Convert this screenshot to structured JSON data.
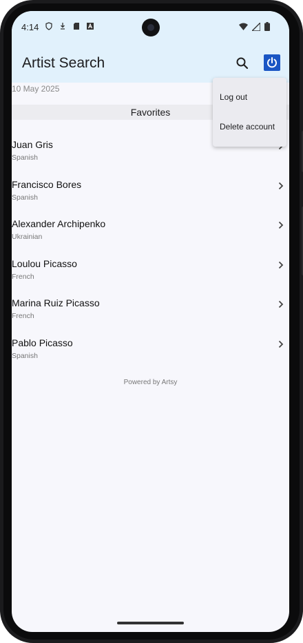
{
  "status_bar": {
    "time": "4:14"
  },
  "app_bar": {
    "title": "Artist Search"
  },
  "date": "10 May 2025",
  "section_title": "Favorites",
  "artists": [
    {
      "name": "Juan Gris",
      "nationality": "Spanish"
    },
    {
      "name": "Francisco Bores",
      "nationality": "Spanish"
    },
    {
      "name": "Alexander Archipenko",
      "nationality": "Ukrainian"
    },
    {
      "name": "Loulou Picasso",
      "nationality": "French"
    },
    {
      "name": "Marina Ruiz Picasso",
      "nationality": "French"
    },
    {
      "name": "Pablo Picasso",
      "nationality": "Spanish"
    }
  ],
  "footer": "Powered by Artsy",
  "menu": {
    "items": [
      "Log out",
      "Delete account"
    ]
  },
  "colors": {
    "app_bar_bg": "#e1f1fc",
    "accent": "#1a56c4",
    "screen_bg": "#f7f7fc"
  }
}
